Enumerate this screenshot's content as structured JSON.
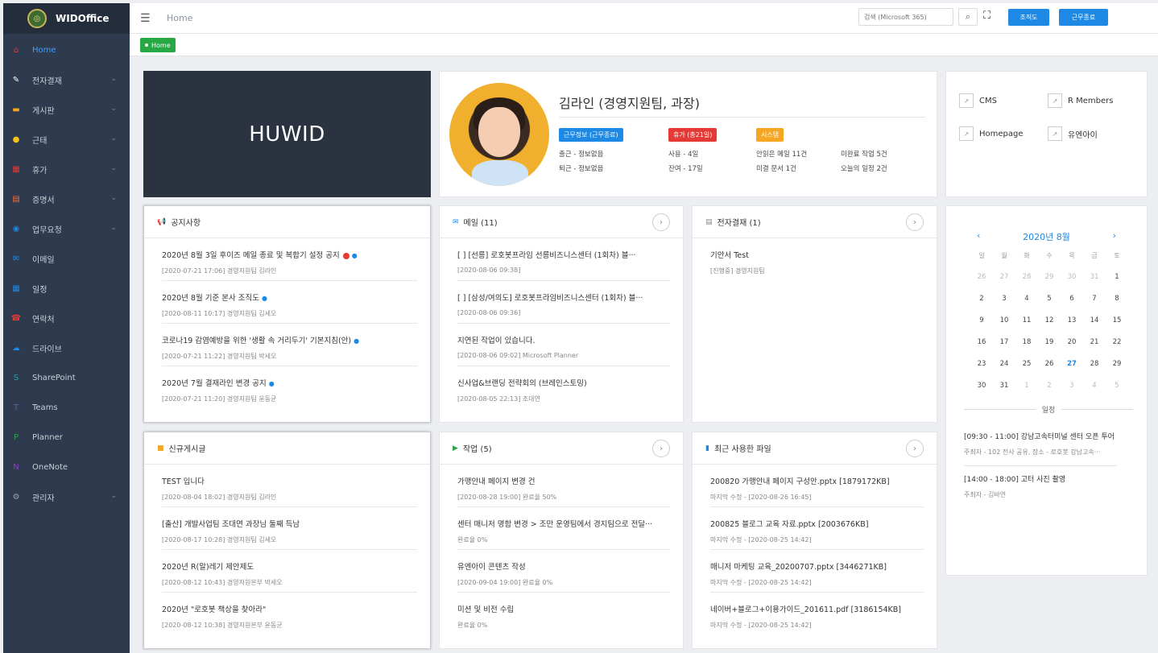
{
  "brand": {
    "name": "WIDOffice"
  },
  "sidebar": {
    "items": [
      {
        "label": "Home",
        "icon": "home-icon",
        "glyph": "⌂",
        "color": "#e53935",
        "chev": false,
        "active": true
      },
      {
        "label": "전자결재",
        "icon": "approval-icon",
        "glyph": "✎",
        "color": "#ffffff",
        "chev": true
      },
      {
        "label": "게시판",
        "icon": "board-icon",
        "glyph": "▬",
        "color": "#f5a623",
        "chev": true
      },
      {
        "label": "근태",
        "icon": "attendance-icon",
        "glyph": "●",
        "color": "#f5c518",
        "chev": true
      },
      {
        "label": "휴가",
        "icon": "vacation-icon",
        "glyph": "▦",
        "color": "#e53935",
        "chev": true
      },
      {
        "label": "증명서",
        "icon": "certificate-icon",
        "glyph": "▤",
        "color": "#f56a3a",
        "chev": true
      },
      {
        "label": "업무요청",
        "icon": "request-icon",
        "glyph": "◉",
        "color": "#1e88e5",
        "chev": true
      },
      {
        "label": "이메일",
        "icon": "email-icon",
        "glyph": "✉",
        "color": "#1e88e5",
        "chev": false
      },
      {
        "label": "일정",
        "icon": "calendar-icon",
        "glyph": "▦",
        "color": "#1e88e5",
        "chev": false
      },
      {
        "label": "연락처",
        "icon": "contacts-icon",
        "glyph": "☎",
        "color": "#e53935",
        "chev": false
      },
      {
        "label": "드라이브",
        "icon": "cloud-icon",
        "glyph": "☁",
        "color": "#1e88e5",
        "chev": false
      },
      {
        "label": "SharePoint",
        "icon": "sharepoint-icon",
        "glyph": "S",
        "color": "#21a3a3",
        "chev": false
      },
      {
        "label": "Teams",
        "icon": "teams-icon",
        "glyph": "T",
        "color": "#6264a7",
        "chev": false
      },
      {
        "label": "Planner",
        "icon": "planner-icon",
        "glyph": "P",
        "color": "#31a24c",
        "chev": false
      },
      {
        "label": "OneNote",
        "icon": "onenote-icon",
        "glyph": "N",
        "color": "#8f3fc4",
        "chev": false
      },
      {
        "label": "관리자",
        "icon": "gear-icon",
        "glyph": "⚙",
        "color": "#9aa3b0",
        "chev": true
      }
    ]
  },
  "topbar": {
    "title": "Home",
    "search_placeholder": "검색 (Microsoft 365)",
    "org_label": "조직도",
    "end_label": "근무종료"
  },
  "breadcrumb": {
    "label": "Home"
  },
  "banner": {
    "text": "HUWID"
  },
  "profile": {
    "name": "김라인 (경영지원팀, 과장)",
    "badges": [
      "근무정보 (근무종료)",
      "휴가 (총21일)",
      "시스템"
    ],
    "stats": {
      "in": "출근 - 정보없음",
      "out": "퇴근 - 정보없음",
      "used": "사용 - 4일",
      "remain": "잔여 - 17일",
      "unread_mail": "안읽은 메일 11건",
      "unfinished": "미완료 작업 5건",
      "unapproved": "미결 문서 1건",
      "today": "오늘의 일정 2건"
    }
  },
  "links": [
    "CMS",
    "R Members",
    "Homepage",
    "유엔아이"
  ],
  "notice": {
    "title": "공지사항",
    "items": [
      {
        "title": "2020년 8월 3일 후이즈 메일 종료 및 복합기 설정 공지",
        "meta": "[2020-07-21 17:06] 경영지원팀 김라인",
        "red": true,
        "blue": true
      },
      {
        "title": "2020년 8월 기준 본사 조직도",
        "meta": "[2020-08-11 10:17] 경영지원팀 김세오",
        "red": false,
        "blue": true
      },
      {
        "title": "코로나19 감염예방을 위한 '생활 속 거리두기' 기본지침(안)",
        "meta": "[2020-07-21 11:22] 경영지원팀 박세오",
        "red": false,
        "blue": true
      },
      {
        "title": "2020년 7월 결재라인 변경 공지",
        "meta": "[2020-07-21 11:20] 경영지원팀 윤동균",
        "red": false,
        "blue": true
      }
    ]
  },
  "mail": {
    "title": "메일 (11)",
    "items": [
      {
        "title": "[      ] [선릉] 로호봇프라임 선릉비즈니스센터 (1회차) 블···",
        "meta": "[2020-08-06 09:38]"
      },
      {
        "title": "[      ] [삼성/여의도] 로호봇프라임비즈니스센터 (1회차) 블···",
        "meta": "[2020-08-06 09:36]"
      },
      {
        "title": "지연된 작업이 있습니다.",
        "meta": "[2020-08-06 09:02] Microsoft Planner"
      },
      {
        "title": "신사업&브랜딩 전략회의 (브레인스토밍)",
        "meta": "[2020-08-05 22:13] 조대연"
      }
    ]
  },
  "approval": {
    "title": "전자결재 (1)",
    "items": [
      {
        "title": "기안서 Test",
        "meta": "[진행중] 경영지원팀"
      }
    ]
  },
  "newposts": {
    "title": "신규게시글",
    "items": [
      {
        "title": "TEST 입니다",
        "meta": "[2020-08-04 18:02] 경영지원팀 김라인"
      },
      {
        "title": "[출산] 개발사업팀 조대연 과장님 둘째 득남",
        "meta": "[2020-08-17 10:28] 경영지원팀 김세오"
      },
      {
        "title": "2020년 R(알)레기 제안제도",
        "meta": "[2020-08-12 10:43] 경영지원본부 박세오"
      },
      {
        "title": "2020년 \"로호봇 책상을 찾아라\"",
        "meta": "[2020-08-12 10:38] 경영지원본부 윤동균"
      }
    ]
  },
  "tasks": {
    "title": "작업 (5)",
    "items": [
      {
        "title": "가맹안내 페이지 변경 건",
        "meta": "[2020-08-28 19:00] 완료율 50%"
      },
      {
        "title": "센터 매니저 명함 변경 > 조만 운영팀에서 경지팀으로 전달···",
        "meta": "완료율 0%"
      },
      {
        "title": "유엔아이 콘텐츠 작성",
        "meta": "[2020-09-04 19:00] 완료율 0%"
      },
      {
        "title": "미션 및 비전 수립",
        "meta": "완료율 0%"
      }
    ]
  },
  "files": {
    "title": "최근 사용한 파일",
    "items": [
      {
        "title": "200820 가맹안내 페이지 구성안.pptx [1879172KB]",
        "meta": "마지막 수정 - [2020-08-26 16:45]"
      },
      {
        "title": "200825 블로그 교육 자료.pptx [2003676KB]",
        "meta": "마지막 수정 - [2020-08-25 14:42]"
      },
      {
        "title": "매니저 마케팅 교육_20200707.pptx [3446271KB]",
        "meta": "마지막 수정 - [2020-08-25 14:42]"
      },
      {
        "title": "네이버+블로그+이용가이드_201611.pdf [3186154KB]",
        "meta": "마지막 수정 - [2020-08-25 14:42]"
      }
    ]
  },
  "calendar": {
    "title": "2020년 8월",
    "prev": "‹",
    "next": "›",
    "dow": [
      "일",
      "월",
      "화",
      "수",
      "목",
      "금",
      "토"
    ],
    "weeks": [
      [
        "26",
        "27",
        "28",
        "29",
        "30",
        "31",
        "1"
      ],
      [
        "2",
        "3",
        "4",
        "5",
        "6",
        "7",
        "8"
      ],
      [
        "9",
        "10",
        "11",
        "12",
        "13",
        "14",
        "15"
      ],
      [
        "16",
        "17",
        "18",
        "19",
        "20",
        "21",
        "22"
      ],
      [
        "23",
        "24",
        "25",
        "26",
        "27",
        "28",
        "29"
      ],
      [
        "30",
        "31",
        "1",
        "2",
        "3",
        "4",
        "5"
      ]
    ],
    "today": "27",
    "schedule_label": "일정",
    "events": [
      {
        "title": "[09:30 - 11:00] 강남고속터미널 센터 오픈 투어",
        "sub": "주최자 - 102 전사 공유, 장소 - 로호봇 강남고속···"
      },
      {
        "title": "[14:00 - 18:00] 고터 사진 촬영",
        "sub": "주최자 - 김바연"
      }
    ]
  }
}
